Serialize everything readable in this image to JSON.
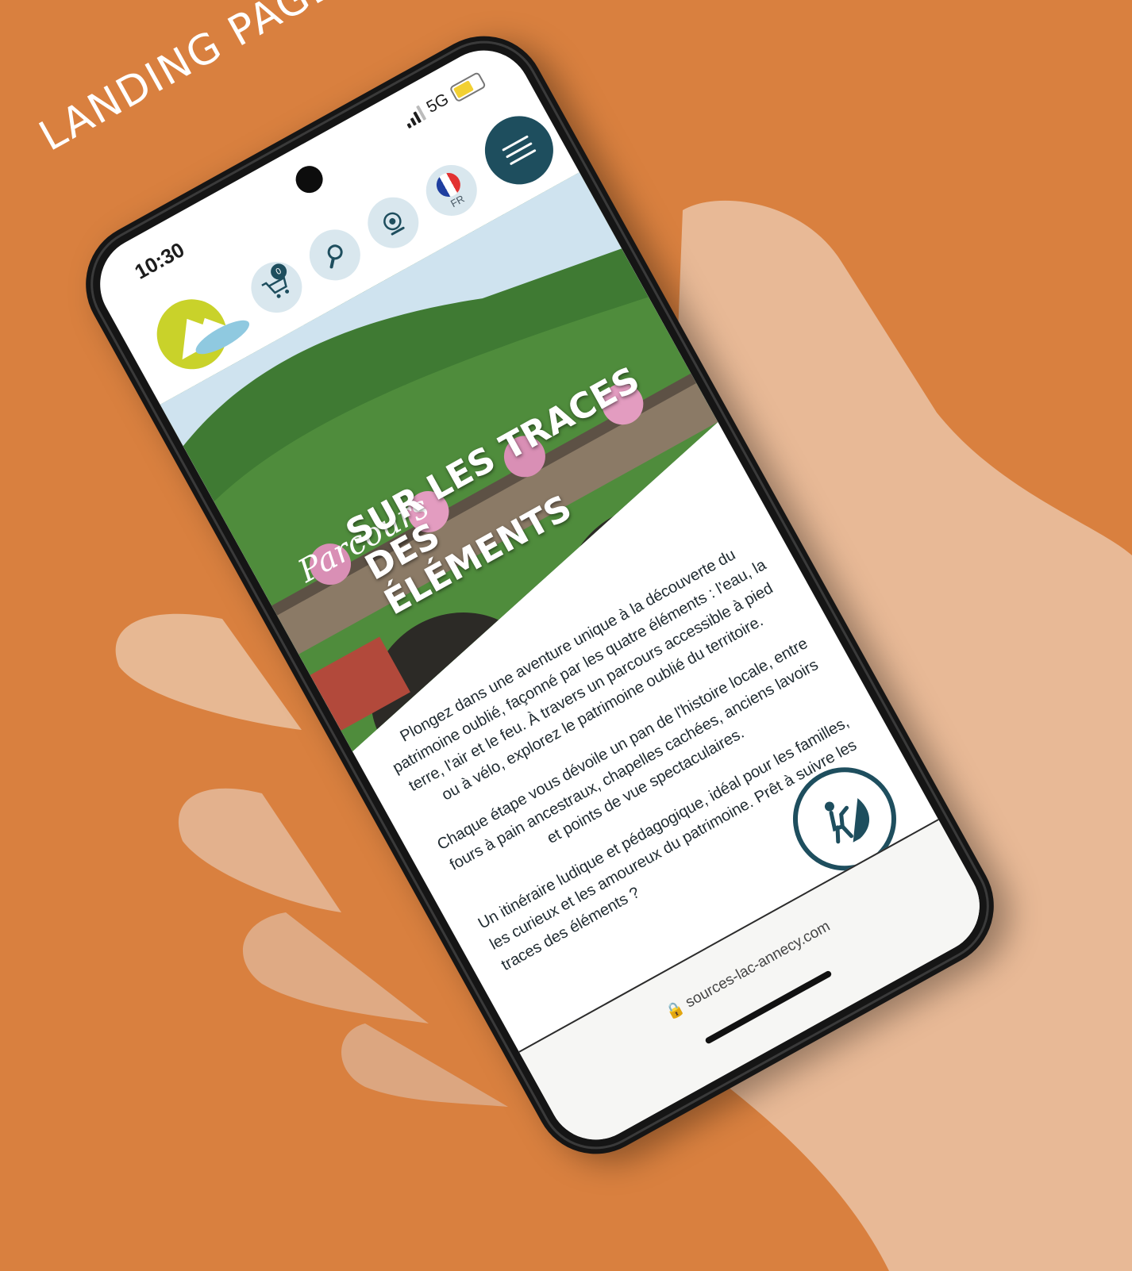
{
  "corner_label": "LANDING PAGE",
  "status": {
    "time": "10:30",
    "network": "5G"
  },
  "header": {
    "cart_count": "0",
    "language_code": "FR"
  },
  "hero": {
    "script_title": "Parcours",
    "title_line1": "SUR LES TRACES DES",
    "title_line2": "ÉLÉMENTS"
  },
  "intro": {
    "p1": "Plongez dans une aventure unique à la découverte du patrimoine oublié, façonné par les quatre éléments : l'eau, la terre, l'air et le feu. À travers un parcours accessible à pied ou à vélo, explorez le patrimoine oublié du territoire.",
    "p2": "Chaque étape vous dévoile un pan de l'histoire locale, entre fours à pain ancestraux, chapelles cachées, anciens lavoirs et points de vue spectaculaires.",
    "p3": "Un itinéraire ludique et pédagogique, idéal pour les familles, les curieux et les amoureux du patrimoine. Prêt à suivre les traces des éléments ?"
  },
  "browser": {
    "url": "sources-lac-annecy.com"
  },
  "icons": [
    "cart-icon",
    "search-icon",
    "webcam-icon",
    "france-flag-icon",
    "menu-icon",
    "hiking-icon",
    "lock-icon",
    "signal-icon",
    "battery-icon"
  ],
  "colors": {
    "background": "#D9803F",
    "brand_teal": "#1E4E5E",
    "logo_lime": "#C9D22A",
    "logo_lake": "#8FC9E0"
  }
}
